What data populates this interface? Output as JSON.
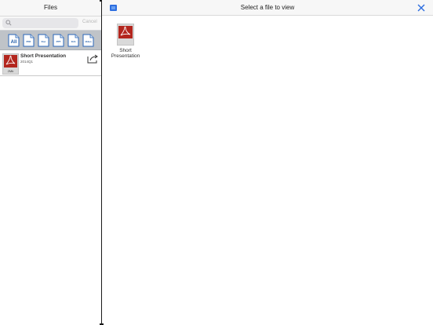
{
  "sidebar": {
    "title": "Files",
    "search": {
      "placeholder": "",
      "value": "",
      "cancel_label": "Cancel"
    },
    "filters": [
      {
        "id": "all",
        "label": "All"
      },
      {
        "id": "pdf",
        "label": "PDF"
      },
      {
        "id": "doc",
        "label": "Doc"
      },
      {
        "id": "ppt",
        "label": "PPT"
      },
      {
        "id": "xls",
        "label": "XLS"
      },
      {
        "id": "video",
        "label": "Video"
      }
    ],
    "files": [
      {
        "name": "Short Presentation",
        "subtitle": "2014Q1",
        "size": "2Mb",
        "icon": "pdf-icon"
      }
    ]
  },
  "main": {
    "title": "Select a file to view",
    "documents": [
      {
        "label": "Short Presentation",
        "icon": "pdf-icon"
      }
    ]
  },
  "colors": {
    "accent": "#2d6ee0",
    "pdf_red": "#b3261e",
    "filter_bar": "#bfc3c8",
    "header_bg": "#f7f7f7"
  }
}
